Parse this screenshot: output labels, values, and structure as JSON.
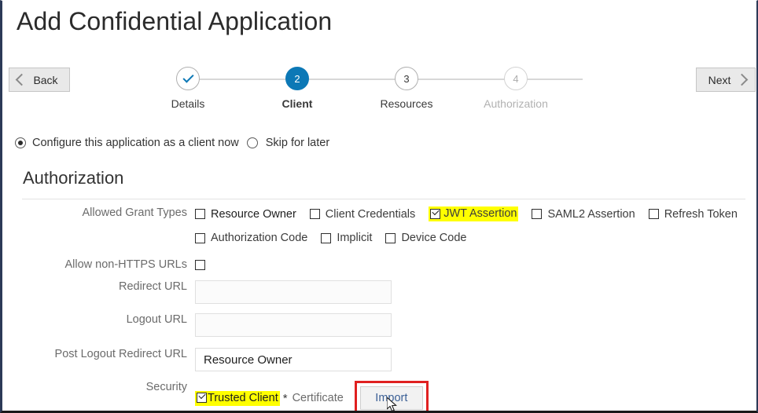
{
  "window": {
    "title": "Add Confidential Application"
  },
  "nav": {
    "back_label": "Back",
    "next_label": "Next",
    "back_icon": "chevron-left-icon",
    "next_icon": "chevron-right-icon"
  },
  "stepper": {
    "steps": [
      {
        "number": "1",
        "label": "Details",
        "state": "done",
        "marker": "✓"
      },
      {
        "number": "2",
        "label": "Client",
        "state": "active",
        "marker": "2"
      },
      {
        "number": "3",
        "label": "Resources",
        "state": "upcoming",
        "marker": "3"
      },
      {
        "number": "4",
        "label": "Authorization",
        "state": "pending",
        "marker": "4"
      }
    ],
    "active_color": "#0c78b6",
    "done_color": "#0078b4",
    "pending_color": "#b1b1b1"
  },
  "mode": {
    "option_configure": "Configure this application as a client now",
    "option_skip": "Skip for later",
    "selected": "configure"
  },
  "section": {
    "title": "Authorization"
  },
  "form": {
    "grant_types": {
      "label": "Allowed Grant Types",
      "row1": [
        {
          "text": "Resource Owner",
          "checked": false,
          "highlight": false
        },
        {
          "text": "Client Credentials",
          "checked": false,
          "highlight": false
        },
        {
          "text": "JWT Assertion",
          "checked": true,
          "highlight": true
        },
        {
          "text": "SAML2 Assertion",
          "checked": false,
          "highlight": false
        },
        {
          "text": "Refresh Token",
          "checked": false,
          "highlight": false
        }
      ],
      "row2": [
        {
          "text": "Authorization Code",
          "checked": false,
          "highlight": false
        },
        {
          "text": "Implicit",
          "checked": false,
          "highlight": false
        },
        {
          "text": "Device Code",
          "checked": false,
          "highlight": false
        }
      ]
    },
    "allow_non_https": {
      "label": "Allow non-HTTPS URLs",
      "checked": false
    },
    "redirect_url": {
      "label": "Redirect URL",
      "value": "",
      "placeholder": ""
    },
    "logout_url": {
      "label": "Logout URL",
      "value": "",
      "placeholder": ""
    },
    "post_logout_redirect_url": {
      "label": "Post Logout Redirect URL",
      "value": "Resource Owner",
      "placeholder": ""
    },
    "security": {
      "label": "Security",
      "trusted_client_text": "Trusted Client",
      "trusted_client_checked": true,
      "trusted_client_highlight": true,
      "required_marker": "*",
      "certificate_label": "Certificate",
      "import_label": "Import"
    }
  },
  "annotations": {
    "highlight_color": "#ffff00",
    "callout_border_color": "#e02020",
    "cursor_icon": "mouse-pointer-icon"
  }
}
